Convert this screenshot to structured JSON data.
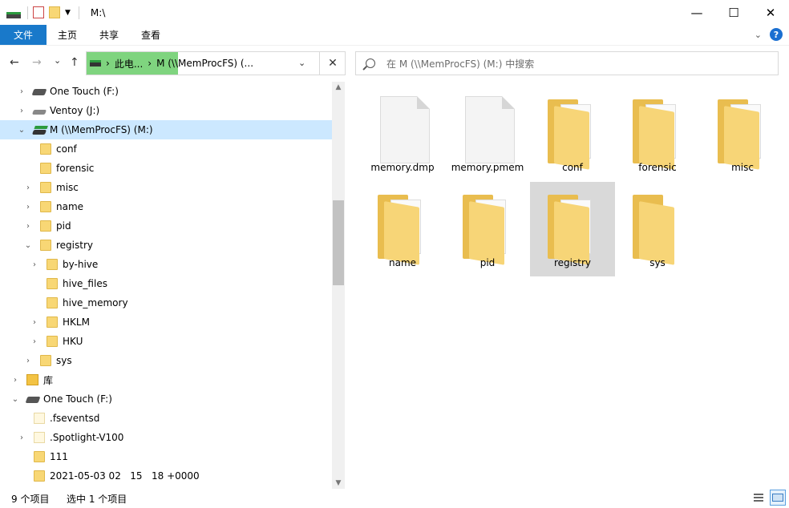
{
  "window": {
    "title": "M:\\",
    "controls": {
      "minimize": "—",
      "maximize": "☐",
      "close": "✕"
    }
  },
  "ribbon": {
    "tabs": [
      {
        "label": "文件"
      },
      {
        "label": "主页"
      },
      {
        "label": "共享"
      },
      {
        "label": "查看"
      }
    ],
    "help": "?"
  },
  "nav": {
    "back": "←",
    "forward": "→",
    "recent": "⌄",
    "up": "↑",
    "address": {
      "crumb1": "此电...",
      "crumb2": "M (\\\\MemProcFS) (...",
      "sep": "›"
    },
    "address_clear": "✕",
    "search_placeholder": "在 M (\\\\MemProcFS) (M:) 中搜索"
  },
  "tree": [
    {
      "label": "One Touch (F:)"
    },
    {
      "label": "Ventoy (J:)"
    },
    {
      "label": "M (\\\\MemProcFS) (M:)"
    },
    {
      "label": "conf"
    },
    {
      "label": "forensic"
    },
    {
      "label": "misc"
    },
    {
      "label": "name"
    },
    {
      "label": "pid"
    },
    {
      "label": "registry"
    },
    {
      "label": "by-hive"
    },
    {
      "label": "hive_files"
    },
    {
      "label": "hive_memory"
    },
    {
      "label": "HKLM"
    },
    {
      "label": "HKU"
    },
    {
      "label": "sys"
    },
    {
      "label": "库"
    },
    {
      "label": "One Touch (F:)"
    },
    {
      "label": ".fseventsd"
    },
    {
      "label": ".Spotlight-V100"
    },
    {
      "label": "111"
    },
    {
      "label": "2021-05-03 02   15   18 +0000"
    }
  ],
  "files": [
    {
      "label": "memory.dmp",
      "type": "file"
    },
    {
      "label": "memory.pmem",
      "type": "file"
    },
    {
      "label": "conf",
      "type": "folder"
    },
    {
      "label": "forensic",
      "type": "folder"
    },
    {
      "label": "misc",
      "type": "folder"
    },
    {
      "label": "name",
      "type": "folder"
    },
    {
      "label": "pid",
      "type": "folder"
    },
    {
      "label": "registry",
      "type": "folder"
    },
    {
      "label": "sys",
      "type": "folder"
    }
  ],
  "status": {
    "count": "9 个项目",
    "selected": "选中 1 个项目"
  },
  "colors": {
    "file_tab": "#1979ca",
    "selection": "#cce8ff",
    "address_highlight": "#7fd47f"
  }
}
